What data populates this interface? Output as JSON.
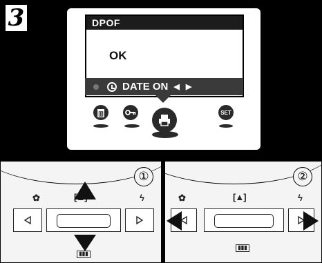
{
  "step_number": "3",
  "screen": {
    "dialog_title": "DPOF",
    "dialog_message": "OK",
    "date_bar": "DATE ON",
    "icons": [
      "trash-icon",
      "key-icon",
      "print-icon",
      "set-icon"
    ],
    "set_label": "SET"
  },
  "panels": [
    {
      "step_label": "①",
      "macro_icon": "flower-icon",
      "frame_glyph": "[▲]",
      "flash_icon": "ϟ",
      "multi_glyph": "▮▮▮",
      "active_buttons": [
        "up",
        "down"
      ]
    },
    {
      "step_label": "②",
      "macro_icon": "flower-icon",
      "frame_glyph": "[▲]",
      "flash_icon": "ϟ",
      "multi_glyph": "▮▮▮",
      "active_buttons": [
        "left",
        "right"
      ]
    }
  ]
}
